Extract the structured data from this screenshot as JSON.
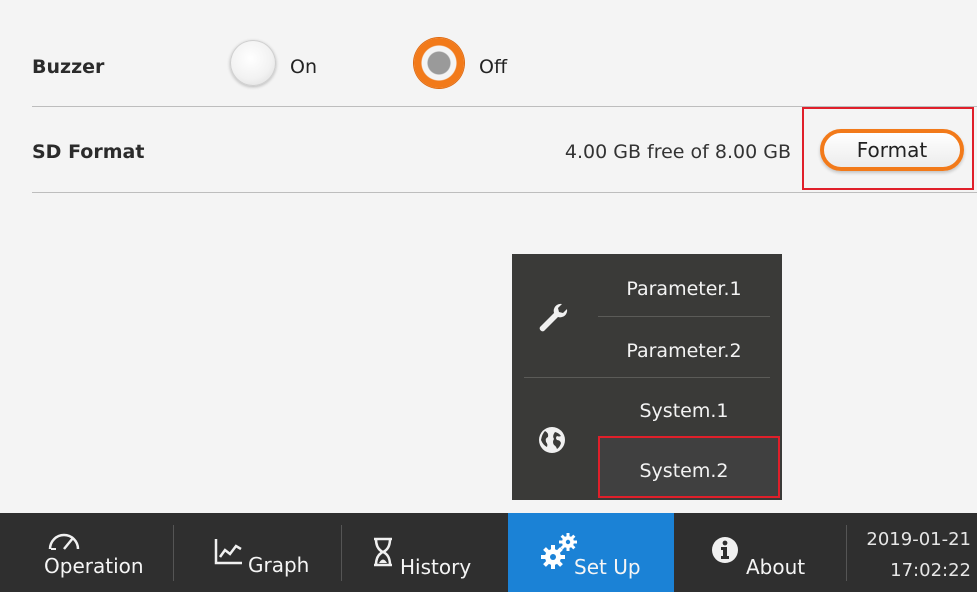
{
  "settings": {
    "buzzer": {
      "label": "Buzzer",
      "options": [
        {
          "label": "On",
          "selected": false
        },
        {
          "label": "Off",
          "selected": true
        }
      ]
    },
    "sd_format": {
      "label": "SD Format",
      "info": "4.00 GB free of 8.00 GB",
      "button_label": "Format"
    }
  },
  "menu": {
    "items": [
      {
        "label": "Parameter.1",
        "group": "wrench-icon"
      },
      {
        "label": "Parameter.2",
        "group": "wrench-icon"
      },
      {
        "label": "System.1",
        "group": "globe-icon"
      },
      {
        "label": "System.2",
        "group": "globe-icon"
      }
    ]
  },
  "nav": {
    "tabs": [
      {
        "label": "Operation",
        "icon": "gauge-icon",
        "active": false
      },
      {
        "label": "Graph",
        "icon": "chart-icon",
        "active": false
      },
      {
        "label": "History",
        "icon": "hourglass-icon",
        "active": false
      },
      {
        "label": "Set Up",
        "icon": "gears-icon",
        "active": true
      },
      {
        "label": "About",
        "icon": "info-icon",
        "active": false
      }
    ],
    "date": "2019-01-21",
    "time": "17:02:22"
  },
  "colors": {
    "accent_orange": "#f27a1a",
    "active_tab_blue": "#1b82d6",
    "highlight_red": "#e01f2a",
    "nav_bg": "#2f2f2f",
    "menu_bg": "#3a3a38"
  }
}
